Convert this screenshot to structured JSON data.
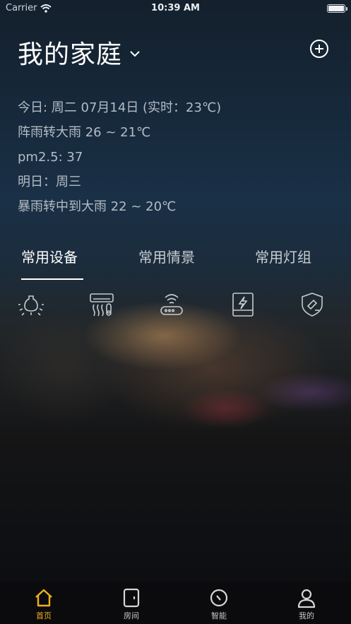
{
  "status": {
    "carrier": "Carrier",
    "time": "10:39 AM",
    "battery_level": 1.0
  },
  "header": {
    "title": "我的家庭"
  },
  "weather": {
    "today": "今日: 周二 07月14日 (实时：23℃)",
    "today_condition": "阵雨转大雨 26 ~ 21℃",
    "pm25": "pm2.5: 37",
    "tomorrow": "明日：周三",
    "tomorrow_condition": "暴雨转中到大雨 22 ~ 20℃"
  },
  "tabs": [
    {
      "label": "常用设备",
      "active": true
    },
    {
      "label": "常用情景",
      "active": false
    },
    {
      "label": "常用灯组",
      "active": false
    }
  ],
  "devices": [
    "light-bulb-icon",
    "air-conditioner-icon",
    "router-icon",
    "power-panel-icon",
    "security-shield-icon"
  ],
  "tabbar": {
    "items": [
      {
        "label": "首页",
        "icon": "home-icon",
        "active": true
      },
      {
        "label": "房间",
        "icon": "door-icon",
        "active": false
      },
      {
        "label": "智能",
        "icon": "timer-icon",
        "active": false
      },
      {
        "label": "我的",
        "icon": "profile-icon",
        "active": false
      }
    ],
    "active_color": "#f2b01e"
  }
}
